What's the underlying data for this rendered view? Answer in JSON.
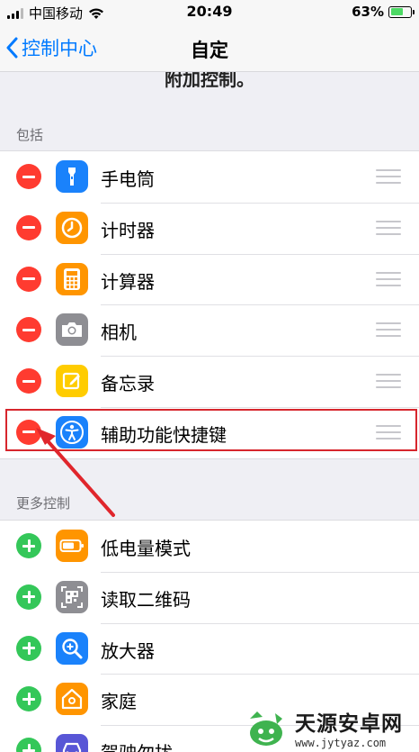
{
  "status_bar": {
    "carrier": "中国移动",
    "time": "20:49",
    "battery": "63%",
    "battery_level": 0.63
  },
  "nav": {
    "back_label": "控制中心",
    "title": "自定"
  },
  "partial_text": "附加控制。",
  "included": {
    "header": "包括",
    "items": [
      {
        "label": "手电筒",
        "icon": "flashlight-icon",
        "color": "#1a82fb"
      },
      {
        "label": "计时器",
        "icon": "timer-icon",
        "color": "#ff9500"
      },
      {
        "label": "计算器",
        "icon": "calculator-icon",
        "color": "#ff9500"
      },
      {
        "label": "相机",
        "icon": "camera-icon",
        "color": "#8e8e93"
      },
      {
        "label": "备忘录",
        "icon": "notes-icon",
        "color": "#ffcc00"
      },
      {
        "label": "辅助功能快捷键",
        "icon": "accessibility-icon",
        "color": "#1a82fb"
      }
    ]
  },
  "more": {
    "header": "更多控制",
    "items": [
      {
        "label": "低电量模式",
        "icon": "low-power-icon",
        "color": "#ff9500"
      },
      {
        "label": "读取二维码",
        "icon": "qr-code-icon",
        "color": "#8e8e93"
      },
      {
        "label": "放大器",
        "icon": "magnifier-icon",
        "color": "#1a82fb"
      },
      {
        "label": "家庭",
        "icon": "home-icon",
        "color": "#ff9500"
      },
      {
        "label": "驾驶勿扰",
        "icon": "car-icon",
        "color": "#5856d6"
      }
    ]
  },
  "watermark": {
    "title": "天源安卓网",
    "url": "www.jytyaz.com"
  },
  "colors": {
    "accent": "#007aff",
    "remove": "#ff3b30",
    "add": "#34c759",
    "highlight": "#d7262d"
  }
}
